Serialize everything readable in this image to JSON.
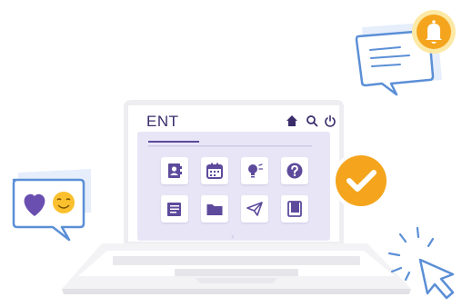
{
  "laptop": {
    "app_title": "ENT",
    "next_indicator": "›"
  },
  "header_icons": [
    "home-icon",
    "search-icon",
    "power-icon"
  ],
  "tiles": [
    {
      "icon": "contacts-book-icon"
    },
    {
      "icon": "calendar-icon"
    },
    {
      "icon": "lightbulb-icon"
    },
    {
      "icon": "help-question-icon"
    },
    {
      "icon": "document-icon"
    },
    {
      "icon": "folder-icon"
    },
    {
      "icon": "send-paper-plane-icon"
    },
    {
      "icon": "book-icon"
    }
  ],
  "decorations": [
    "chat-bubble-heart-smiley",
    "notification-bell-bubble",
    "checkmark-badge",
    "cursor-click"
  ],
  "colors": {
    "primary": "#5d4a9c",
    "purple_dark": "#3a2c6b",
    "orange": "#f4a51d",
    "yellow": "#fbc02d",
    "bubble_blue": "#5b8fd6",
    "bubble_bg": "#f3f6ff",
    "screen_bg": "#e8e6f6"
  }
}
